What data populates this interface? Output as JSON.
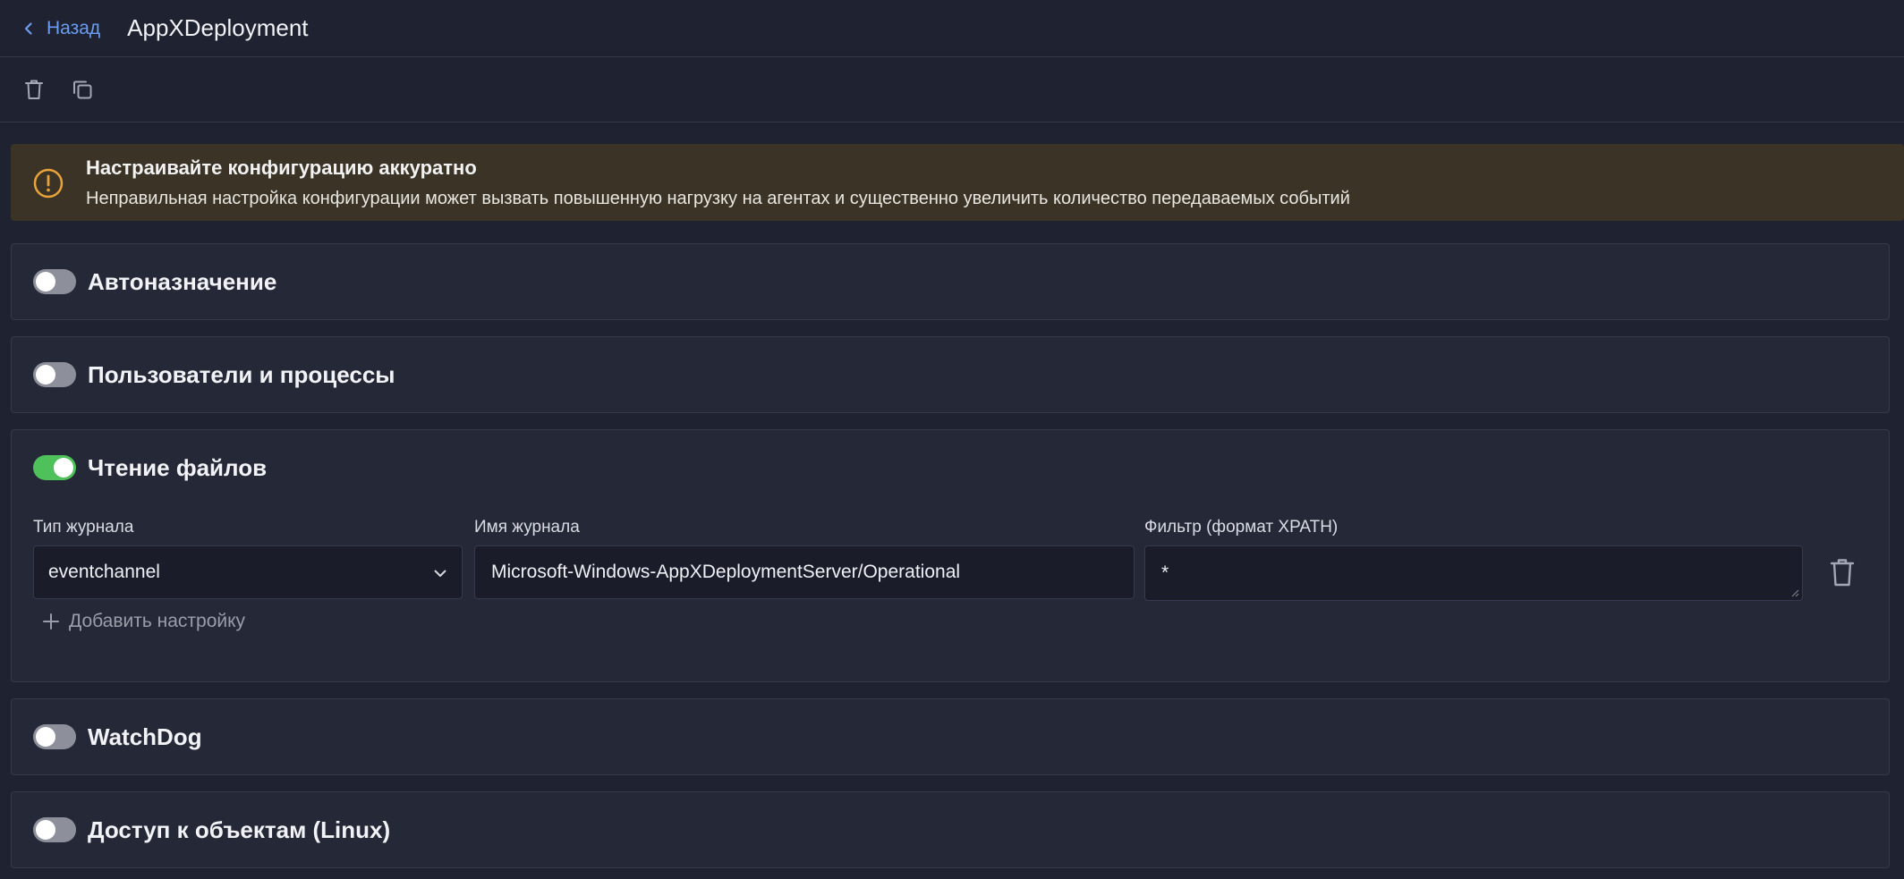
{
  "header": {
    "back_label": "Назад",
    "title": "AppXDeployment"
  },
  "toolbar": {
    "delete_icon": "trash-icon",
    "copy_icon": "copy-icon"
  },
  "warning": {
    "title": "Настраивайте конфигурацию аккуратно",
    "text": "Неправильная настройка конфигурации может вызвать повышенную нагрузку на агентах и существенно увеличить количество передаваемых событий",
    "color": "#e8a33a"
  },
  "sections": [
    {
      "title": "Автоназначение",
      "enabled": false
    },
    {
      "title": "Пользователи и процессы",
      "enabled": false
    },
    {
      "title": "Чтение файлов",
      "enabled": true
    },
    {
      "title": "WatchDog",
      "enabled": false
    },
    {
      "title": "Доступ к объектам (Linux)",
      "enabled": false
    }
  ],
  "file_reading": {
    "log_type_label": "Тип журнала",
    "log_type_value": "eventchannel",
    "log_name_label": "Имя журнала",
    "log_name_value": "Microsoft-Windows-AppXDeploymentServer/Operational",
    "filter_label": "Фильтр (формат XPATH)",
    "filter_value": "*",
    "add_setting_label": "Добавить настройку"
  },
  "colors": {
    "accent": "#6a9df2",
    "toggle_on": "#4fc15a",
    "toggle_off": "#8d909b"
  }
}
